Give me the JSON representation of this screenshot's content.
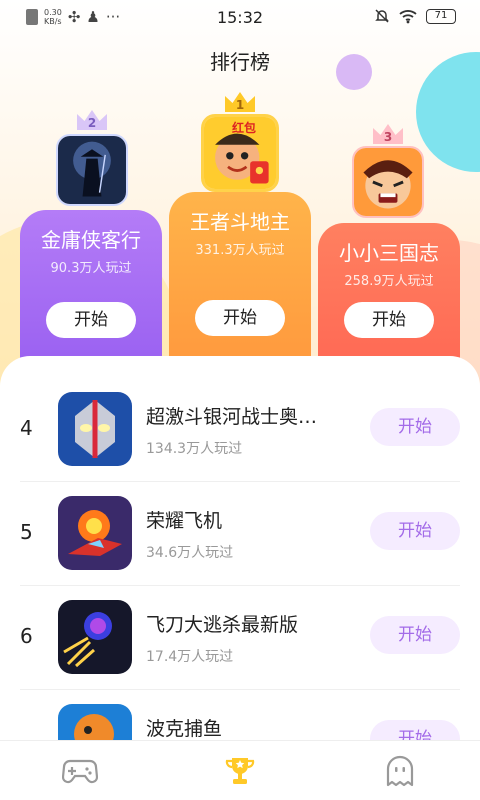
{
  "status_bar": {
    "network_speed": "0.30\nKB/s",
    "time": "15:32",
    "battery": "71"
  },
  "header": {
    "title": "排行榜"
  },
  "podium": [
    {
      "rank": "2",
      "name": "金庸侠客行",
      "plays": "90.3万人玩过",
      "button": "开始",
      "icon": "swordsman-silhouette-icon"
    },
    {
      "rank": "1",
      "name": "王者斗地主",
      "plays": "331.3万人玩过",
      "button": "开始",
      "icon": "cartoon-cardplayer-icon",
      "icon_badge": "红包"
    },
    {
      "rank": "3",
      "name": "小小三国志",
      "plays": "258.9万人玩过",
      "button": "开始",
      "icon": "angry-warrior-icon"
    }
  ],
  "list": [
    {
      "rank": "4",
      "name": "超激斗银河战士奥…",
      "plays": "134.3万人玩过",
      "button": "开始",
      "icon": "ultraman-icon"
    },
    {
      "rank": "5",
      "name": "荣耀飞机",
      "plays": "34.6万人玩过",
      "button": "开始",
      "icon": "fighter-plane-icon"
    },
    {
      "rank": "6",
      "name": "飞刀大逃杀最新版",
      "plays": "17.4万人玩过",
      "button": "开始",
      "icon": "flying-knife-icon"
    },
    {
      "rank": "",
      "name": "波克捕鱼",
      "plays": "",
      "button": "开始",
      "icon": "fishing-game-icon"
    }
  ],
  "bottom_nav": [
    {
      "icon": "gamepad-icon",
      "active": false
    },
    {
      "icon": "trophy-icon",
      "active": true
    },
    {
      "icon": "ghost-icon",
      "active": false
    }
  ],
  "colors": {
    "accent_purple": "#a36be8",
    "podium_purple": "#9b62f1",
    "podium_orange": "#ff9a3e",
    "podium_red": "#ff6a55",
    "trophy_active": "#ffc928"
  }
}
